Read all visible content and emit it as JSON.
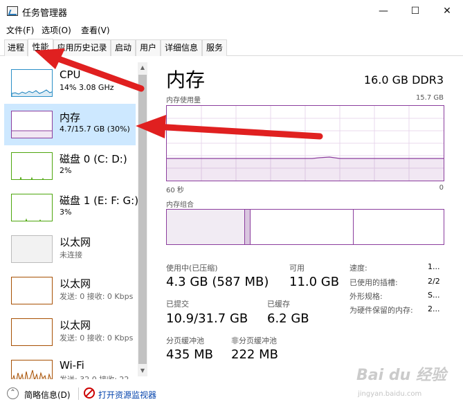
{
  "window": {
    "title": "任务管理器"
  },
  "menu": [
    "文件(F)",
    "选项(O)",
    "查看(V)"
  ],
  "tabs": [
    "进程",
    "性能",
    "应用历史记录",
    "启动",
    "用户",
    "详细信息",
    "服务"
  ],
  "active_tab": "性能",
  "sidebar": {
    "items": [
      {
        "name": "CPU",
        "sub": "14%  3.08 GHz",
        "color": "#117dbb"
      },
      {
        "name": "内存",
        "sub": "4.7/15.7 GB (30%)",
        "color": "#8b3d9d"
      },
      {
        "name": "磁盘 0 (C: D:)",
        "sub": "2%",
        "color": "#4da60c"
      },
      {
        "name": "磁盘 1 (E: F: G:)",
        "sub": "3%",
        "color": "#4da60c"
      },
      {
        "name": "以太网",
        "sub": "未连接",
        "color": "#999999"
      },
      {
        "name": "以太网",
        "sub": "发送: 0 接收: 0 Kbps",
        "color": "#a74f01"
      },
      {
        "name": "以太网",
        "sub": "发送: 0 接收: 0 Kbps",
        "color": "#a74f01"
      },
      {
        "name": "Wi-Fi",
        "sub": "发送: 32.0  接收: 22",
        "color": "#a74f01"
      }
    ]
  },
  "main": {
    "title": "内存",
    "spec": "16.0 GB DDR3",
    "usage_label": "内存使用量",
    "usage_max": "15.7 GB",
    "time_left": "60 秒",
    "time_right": "0",
    "composition_label": "内存组合",
    "stats": {
      "in_use_label": "使用中(已压缩)",
      "in_use_value": "4.3 GB (587 MB)",
      "available_label": "可用",
      "available_value": "11.0 GB",
      "committed_label": "已提交",
      "committed_value": "10.9/31.7 GB",
      "cached_label": "已缓存",
      "cached_value": "6.2 GB",
      "paged_label": "分页缓冲池",
      "paged_value": "435 MB",
      "nonpaged_label": "非分页缓冲池",
      "nonpaged_value": "222 MB"
    },
    "side": {
      "speed_label": "速度:",
      "speed_value": "1...",
      "slots_label": "已使用的插槽:",
      "slots_value": "2/2",
      "form_label": "外形规格:",
      "form_value": "S...",
      "reserved_label": "为硬件保留的内存:",
      "reserved_value": "2..."
    }
  },
  "bottom": {
    "fewer_details": "简略信息(D)",
    "open_monitor": "打开资源监视器"
  },
  "watermark": {
    "brand": "Bai du 经验",
    "url": "jingyan.baidu.com"
  },
  "accent": {
    "memory": "#8b3d9d",
    "cpu": "#117dbb",
    "disk": "#4da60c",
    "net": "#a74f01",
    "arrow": "#e02020"
  }
}
